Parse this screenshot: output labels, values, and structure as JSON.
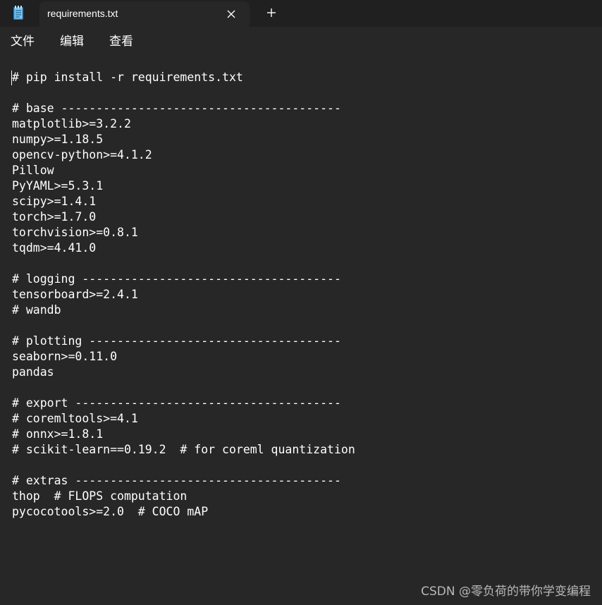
{
  "window": {
    "tab_title": "requirements.txt",
    "app_icon": "notepad-icon",
    "close_icon": "close-icon",
    "new_tab_icon": "plus-icon"
  },
  "menu": {
    "file": "文件",
    "edit": "编辑",
    "view": "查看"
  },
  "document": {
    "text": "# pip install -r requirements.txt\n\n# base ----------------------------------------\nmatplotlib>=3.2.2\nnumpy>=1.18.5\nopencv-python>=4.1.2\nPillow\nPyYAML>=5.3.1\nscipy>=1.4.1\ntorch>=1.7.0\ntorchvision>=0.8.1\ntqdm>=4.41.0\n\n# logging -------------------------------------\ntensorboard>=2.4.1\n# wandb\n\n# plotting ------------------------------------\nseaborn>=0.11.0\npandas\n\n# export --------------------------------------\n# coremltools>=4.1\n# onnx>=1.8.1\n# scikit-learn==0.19.2  # for coreml quantization\n\n# extras --------------------------------------\nthop  # FLOPS computation\npycocotools>=2.0  # COCO mAP"
  },
  "watermark": "CSDN @零负荷的带你学变编程",
  "colors": {
    "titlebar": "#202020",
    "background": "#272727",
    "text": "#ffffff",
    "icon_accent": "#3aa0d8"
  }
}
